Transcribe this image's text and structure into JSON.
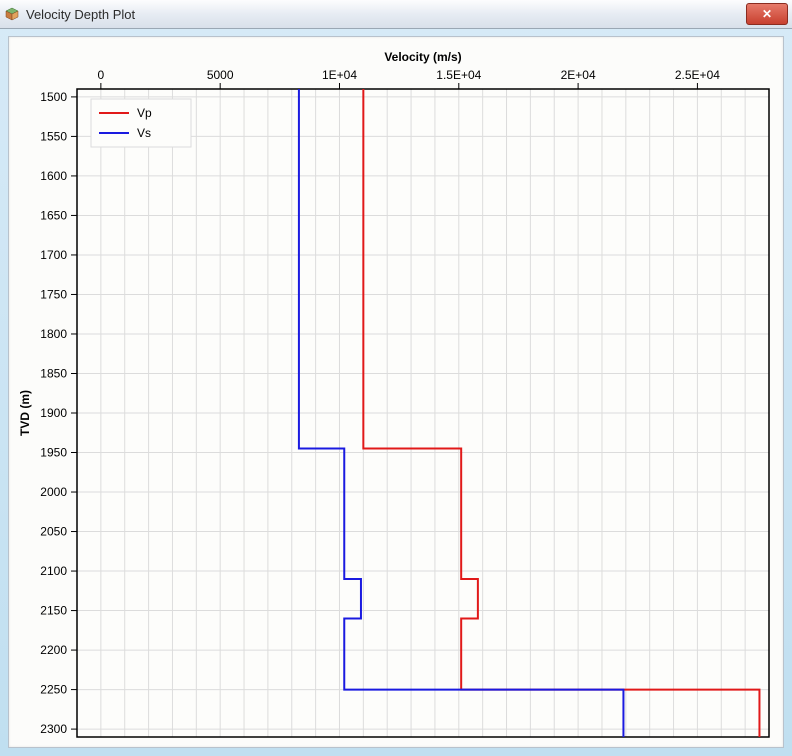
{
  "window": {
    "title": "Velocity Depth Plot",
    "close_tooltip": "Close"
  },
  "chart_data": {
    "type": "line",
    "title": "",
    "xlabel": "Velocity (m/s)",
    "ylabel": "TVD (m)",
    "xlim": [
      -1000,
      28000
    ],
    "ylim": [
      2310,
      1490
    ],
    "x_ticks": [
      0,
      5000,
      10000,
      15000,
      20000,
      25000
    ],
    "x_tick_labels": [
      "0",
      "5000",
      "1E+04",
      "1.5E+04",
      "2E+04",
      "2.5E+04"
    ],
    "y_ticks": [
      1500,
      1550,
      1600,
      1650,
      1700,
      1750,
      1800,
      1850,
      1900,
      1950,
      2000,
      2050,
      2100,
      2150,
      2200,
      2250,
      2300
    ],
    "grid": true,
    "x_axis_position": "top",
    "y_reversed": true,
    "legend": {
      "position": "upper-left",
      "entries": [
        "Vp",
        "Vs"
      ]
    },
    "series": [
      {
        "name": "Vp",
        "color": "#e11919",
        "points": [
          {
            "x": 11000,
            "y": 1490
          },
          {
            "x": 11000,
            "y": 1945
          },
          {
            "x": 15100,
            "y": 1945
          },
          {
            "x": 15100,
            "y": 2110
          },
          {
            "x": 15800,
            "y": 2110
          },
          {
            "x": 15800,
            "y": 2160
          },
          {
            "x": 15100,
            "y": 2160
          },
          {
            "x": 15100,
            "y": 2250
          },
          {
            "x": 27600,
            "y": 2250
          },
          {
            "x": 27600,
            "y": 2310
          }
        ]
      },
      {
        "name": "Vs",
        "color": "#1a1ae0",
        "points": [
          {
            "x": 8300,
            "y": 1490
          },
          {
            "x": 8300,
            "y": 1945
          },
          {
            "x": 10200,
            "y": 1945
          },
          {
            "x": 10200,
            "y": 2110
          },
          {
            "x": 10900,
            "y": 2110
          },
          {
            "x": 10900,
            "y": 2160
          },
          {
            "x": 10200,
            "y": 2160
          },
          {
            "x": 10200,
            "y": 2250
          },
          {
            "x": 21900,
            "y": 2250
          },
          {
            "x": 21900,
            "y": 2310
          }
        ]
      }
    ]
  }
}
